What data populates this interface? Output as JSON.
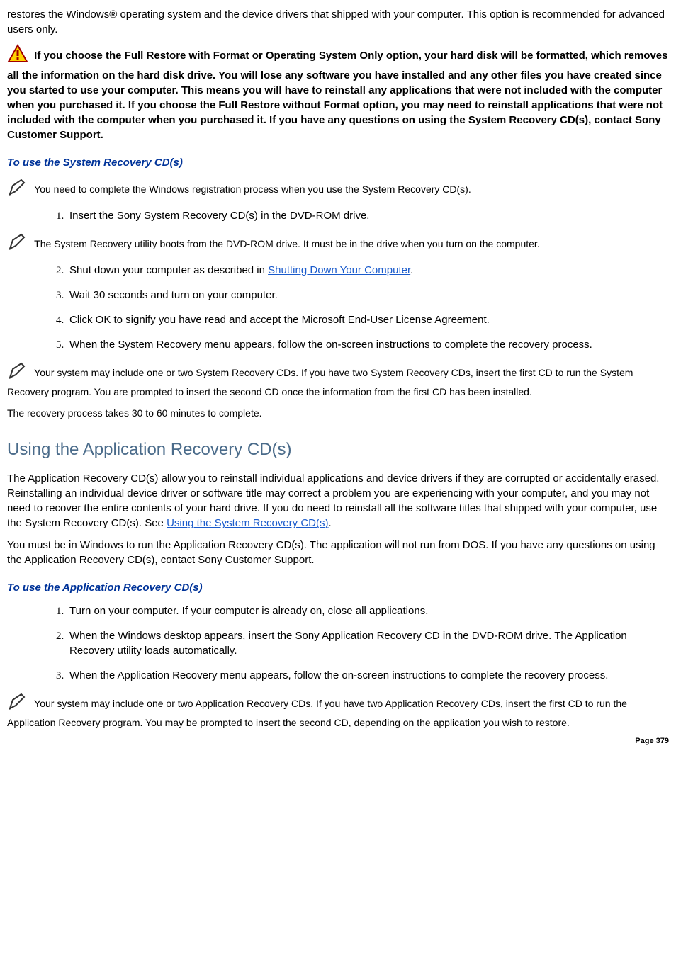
{
  "intro": {
    "restore_text": "restores the Windows® operating system and the device drivers that shipped with your computer. This option is recommended for advanced users only."
  },
  "warning": {
    "text": "If you choose the Full Restore with Format or Operating System Only option, your hard disk will be formatted, which removes all the information on the hard disk drive. You will lose any software you have installed and any other files you have created since you started to use your computer. This means you will have to reinstall any applications that were not included with the computer when you purchased it. If you choose the Full Restore without Format option, you may need to reinstall applications that were not included with the computer when you purchased it. If you have any questions on using the System Recovery CD(s), contact Sony Customer Support."
  },
  "sys_recovery": {
    "heading": "To use the System Recovery CD(s)",
    "note1": "You need to complete the Windows registration process when you use the System Recovery CD(s).",
    "step1": "Insert the Sony System Recovery CD(s) in the DVD-ROM drive.",
    "note2": "The System Recovery utility boots from the DVD-ROM drive. It must be in the drive when you turn on the computer.",
    "step2_pre": "Shut down your computer as described in ",
    "step2_link": "Shutting Down Your Computer",
    "step2_post": ".",
    "step3": "Wait 30 seconds and turn on your computer.",
    "step4": "Click OK to signify you have read and accept the Microsoft End-User License Agreement.",
    "step5": "When the System Recovery menu appears, follow the on-screen instructions to complete the recovery process.",
    "note3": "Your system may include one or two System Recovery CDs. If you have two System Recovery CDs, insert the first CD to run the System Recovery program. You are prompted to insert the second CD once the information from the first CD has been installed.",
    "note4": "The recovery process takes 30 to 60 minutes to complete."
  },
  "app_recovery": {
    "heading": "Using the Application Recovery CD(s)",
    "para1_pre": "The Application Recovery CD(s) allow you to reinstall individual applications and device drivers if they are corrupted or accidentally erased. Reinstalling an individual device driver or software title may correct a problem you are experiencing with your computer, and you may not need to recover the entire contents of your hard drive. If you do need to reinstall all the software titles that shipped with your computer, use the System Recovery CD(s). See ",
    "para1_link": "Using the System Recovery CD(s)",
    "para1_post": ".",
    "para2": "You must be in Windows to run the Application Recovery CD(s). The application will not run from DOS. If you have any questions on using the Application Recovery CD(s), contact Sony Customer Support.",
    "subhead": "To use the Application Recovery CD(s)",
    "step1": "Turn on your computer. If your computer is already on, close all applications.",
    "step2": "When the Windows desktop appears, insert the Sony Application Recovery CD in the DVD-ROM drive. The Application Recovery utility loads automatically.",
    "step3": "When the Application Recovery menu appears, follow the on-screen instructions to complete the recovery process.",
    "note1": "Your system may include one or two Application Recovery CDs. If you have two Application Recovery CDs, insert the first CD to run the Application Recovery program. You may be prompted to insert the second CD, depending on the application you wish to restore."
  },
  "page": "Page 379"
}
